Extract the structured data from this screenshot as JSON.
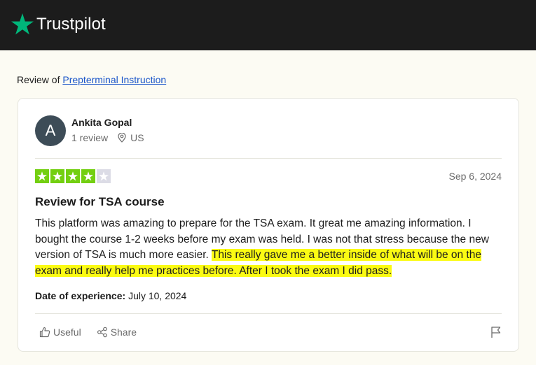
{
  "brand": {
    "name": "Trustpilot",
    "star_color": "#00b67a"
  },
  "review_of": {
    "prefix": "Review of",
    "company": "Prepterminal Instruction"
  },
  "reviewer": {
    "initial": "A",
    "name": "Ankita Gopal",
    "review_count": "1 review",
    "country": "US",
    "location_icon": "location-pin-icon"
  },
  "review": {
    "rating": 4,
    "max_rating": 5,
    "star_color": "#73cf11",
    "date": "Sep 6, 2024",
    "title": "Review for TSA course",
    "body_plain": "This platform was amazing to prepare for the TSA exam. It great me amazing information. I bought the course 1-2 weeks before my exam was held. I was not that stress because the new version of TSA is much more easier.",
    "body_highlighted": "This really gave me a better inside of what will be on the exam and really help me practices before. After I took the exam I did pass.",
    "highlight_color": "#fbfb13",
    "experience_label": "Date of experience:",
    "experience_date": "July 10, 2024"
  },
  "actions": {
    "useful_label": "Useful",
    "useful_icon": "thumbs-up-icon",
    "share_label": "Share",
    "share_icon": "share-icon",
    "flag_icon": "flag-icon"
  }
}
